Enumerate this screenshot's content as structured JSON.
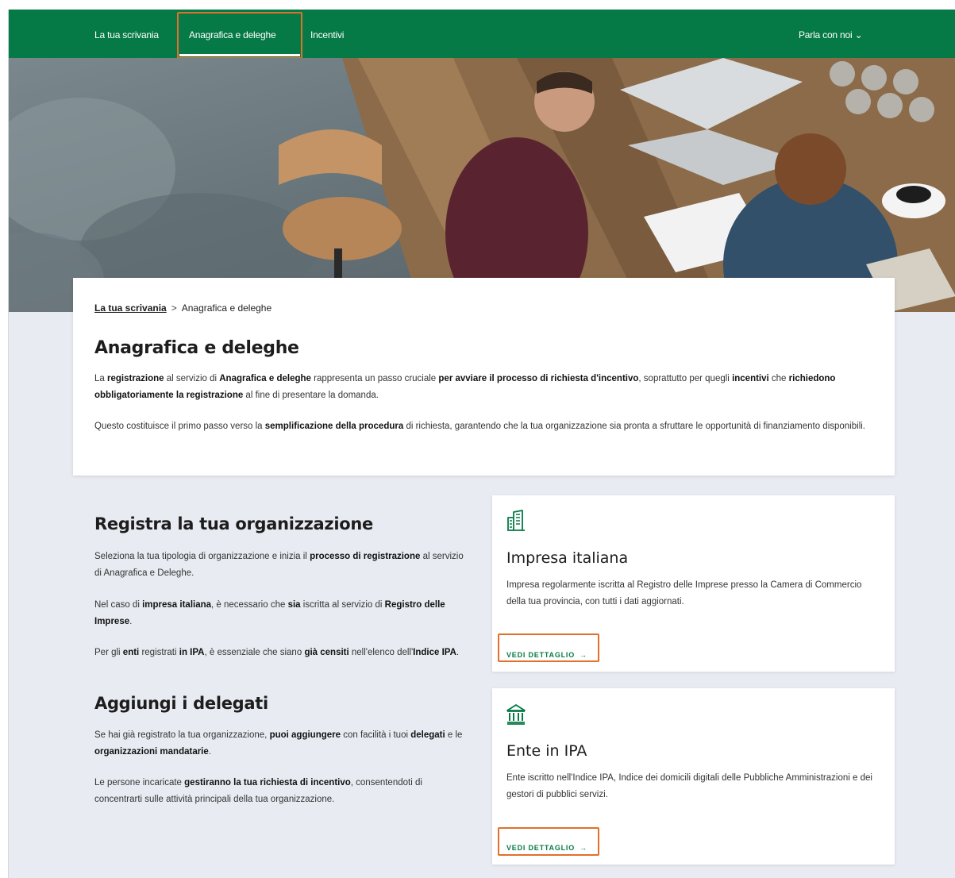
{
  "nav": {
    "items": [
      {
        "label": "La tua scrivania"
      },
      {
        "label": "Anagrafica e deleghe"
      },
      {
        "label": "Incentivi"
      }
    ],
    "talk_label": "Parla con noi",
    "talk_chevron": "⌄"
  },
  "breadcrumb": {
    "home": "La tua scrivania",
    "separator": ">",
    "current": "Anagrafica e deleghe"
  },
  "intro": {
    "title": "Anagrafica e deleghe",
    "p1": [
      {
        "t": "La ",
        "b": false
      },
      {
        "t": "registrazione",
        "b": true
      },
      {
        "t": " al servizio di ",
        "b": false
      },
      {
        "t": "Anagrafica e deleghe",
        "b": true
      },
      {
        "t": " rappresenta un passo cruciale ",
        "b": false
      },
      {
        "t": "per avviare il processo di richiesta d'incentivo",
        "b": true
      },
      {
        "t": ", soprattutto per quegli ",
        "b": false
      },
      {
        "t": "incentivi",
        "b": true
      },
      {
        "t": " che ",
        "b": false
      },
      {
        "t": "richiedono obbligatoriamente la registrazione",
        "b": true
      },
      {
        "t": " al fine di presentare la domanda.",
        "b": false
      }
    ],
    "p2": [
      {
        "t": "Questo costituisce il primo passo verso la ",
        "b": false
      },
      {
        "t": "semplificazione della procedura",
        "b": true
      },
      {
        "t": " di richiesta, garantendo che la tua organizzazione sia pronta a sfruttare le opportunità di finanziamento disponibili.",
        "b": false
      }
    ]
  },
  "register": {
    "title": "Registra la tua organizzazione",
    "p1": [
      {
        "t": "Seleziona la tua tipologia di organizzazione e inizia il ",
        "b": false
      },
      {
        "t": "processo di registrazione",
        "b": true
      },
      {
        "t": " al servizio di Anagrafica e Deleghe.",
        "b": false
      }
    ],
    "p2": [
      {
        "t": "Nel caso di ",
        "b": false
      },
      {
        "t": "impresa italiana",
        "b": true
      },
      {
        "t": ", è necessario che ",
        "b": false
      },
      {
        "t": "sia",
        "b": true
      },
      {
        "t": " iscritta al servizio di ",
        "b": false
      },
      {
        "t": "Registro delle Imprese",
        "b": true
      },
      {
        "t": ".",
        "b": false
      }
    ],
    "p3": [
      {
        "t": "Per gli ",
        "b": false
      },
      {
        "t": "enti",
        "b": true
      },
      {
        "t": " registrati ",
        "b": false
      },
      {
        "t": "in IPA",
        "b": true
      },
      {
        "t": ", è essenziale che siano ",
        "b": false
      },
      {
        "t": "già censiti",
        "b": true
      },
      {
        "t": " nell'elenco dell'",
        "b": false
      },
      {
        "t": "Indice IPA",
        "b": true
      },
      {
        "t": ".",
        "b": false
      }
    ]
  },
  "delegates": {
    "title": "Aggiungi i delegati",
    "p1": [
      {
        "t": "Se hai già registrato la tua organizzazione, ",
        "b": false
      },
      {
        "t": "puoi aggiungere",
        "b": true
      },
      {
        "t": " con facilità i tuoi ",
        "b": false
      },
      {
        "t": "delegati",
        "b": true
      },
      {
        "t": " e le ",
        "b": false
      },
      {
        "t": "organizzazioni mandatarie",
        "b": true
      },
      {
        "t": ".",
        "b": false
      }
    ],
    "p2": [
      {
        "t": "Le persone incaricate ",
        "b": false
      },
      {
        "t": "gestiranno la tua richiesta di incentivo",
        "b": true
      },
      {
        "t": ", consentendoti di concentrarti sulle attività principali della tua organizzazione.",
        "b": false
      }
    ]
  },
  "cards": [
    {
      "icon": "building-icon",
      "title": "Impresa italiana",
      "desc": "Impresa regolarmente iscritta al Registro delle Imprese presso la Camera di Commercio della tua provincia, con tutti i dati aggiornati.",
      "link": "VEDI DETTAGLIO",
      "arrow": "→"
    },
    {
      "icon": "institution-icon",
      "title": "Ente in IPA",
      "desc": "Ente iscritto nell'Indice IPA, Indice dei domicili digitali delle Pubbliche Amministrazioni e dei gestori di pubblici servizi.",
      "link": "VEDI DETTAGLIO",
      "arrow": "→"
    }
  ],
  "colors": {
    "brand_green": "#067a46",
    "highlight_orange": "#e0702a",
    "page_bg": "#e8ecf2"
  }
}
